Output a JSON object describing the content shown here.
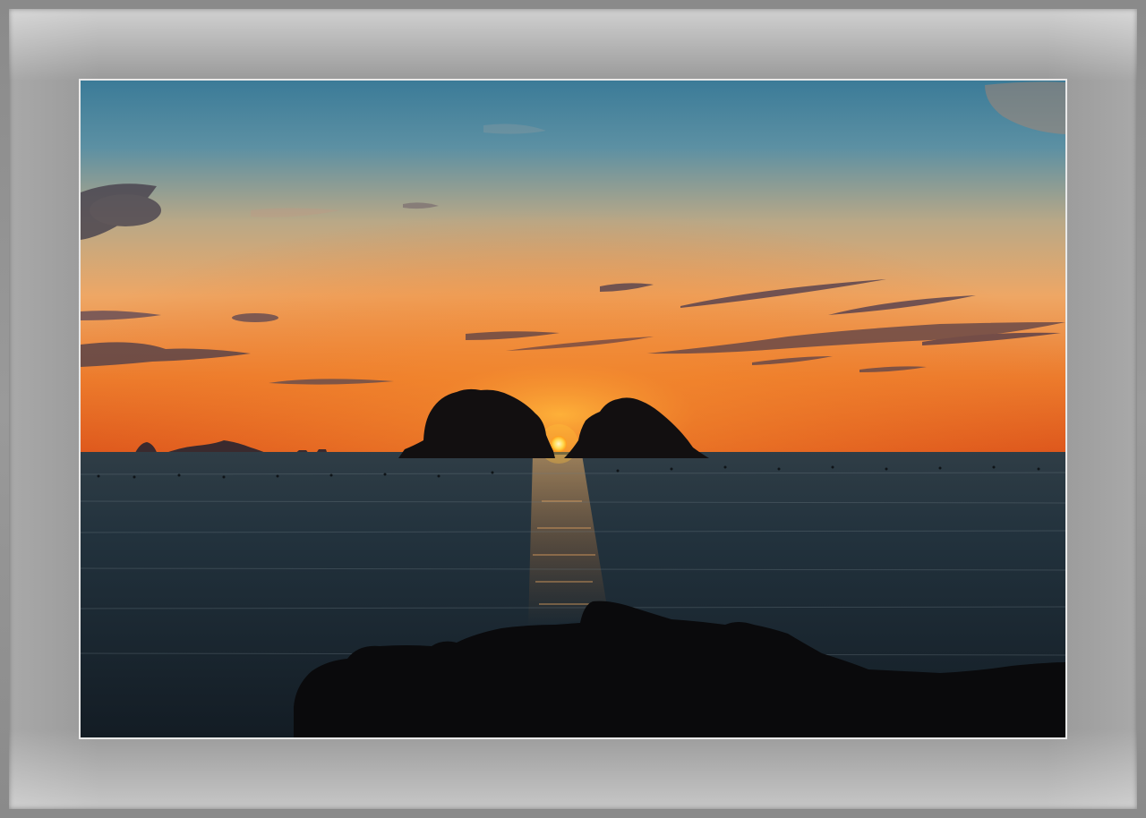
{
  "image": {
    "subject": "sunset-over-sea",
    "colors": {
      "frame": "#999999",
      "mat_highlight": "#d8d8d8",
      "photo_border": "#e9e9e9",
      "sky_top": "#3f7f9c",
      "sky_mid": "#e7a870",
      "sky_horizon": "#e85a1e",
      "sun": "#ffd34a",
      "sea": "#22333f",
      "silhouette": "#0d0d0f"
    }
  }
}
